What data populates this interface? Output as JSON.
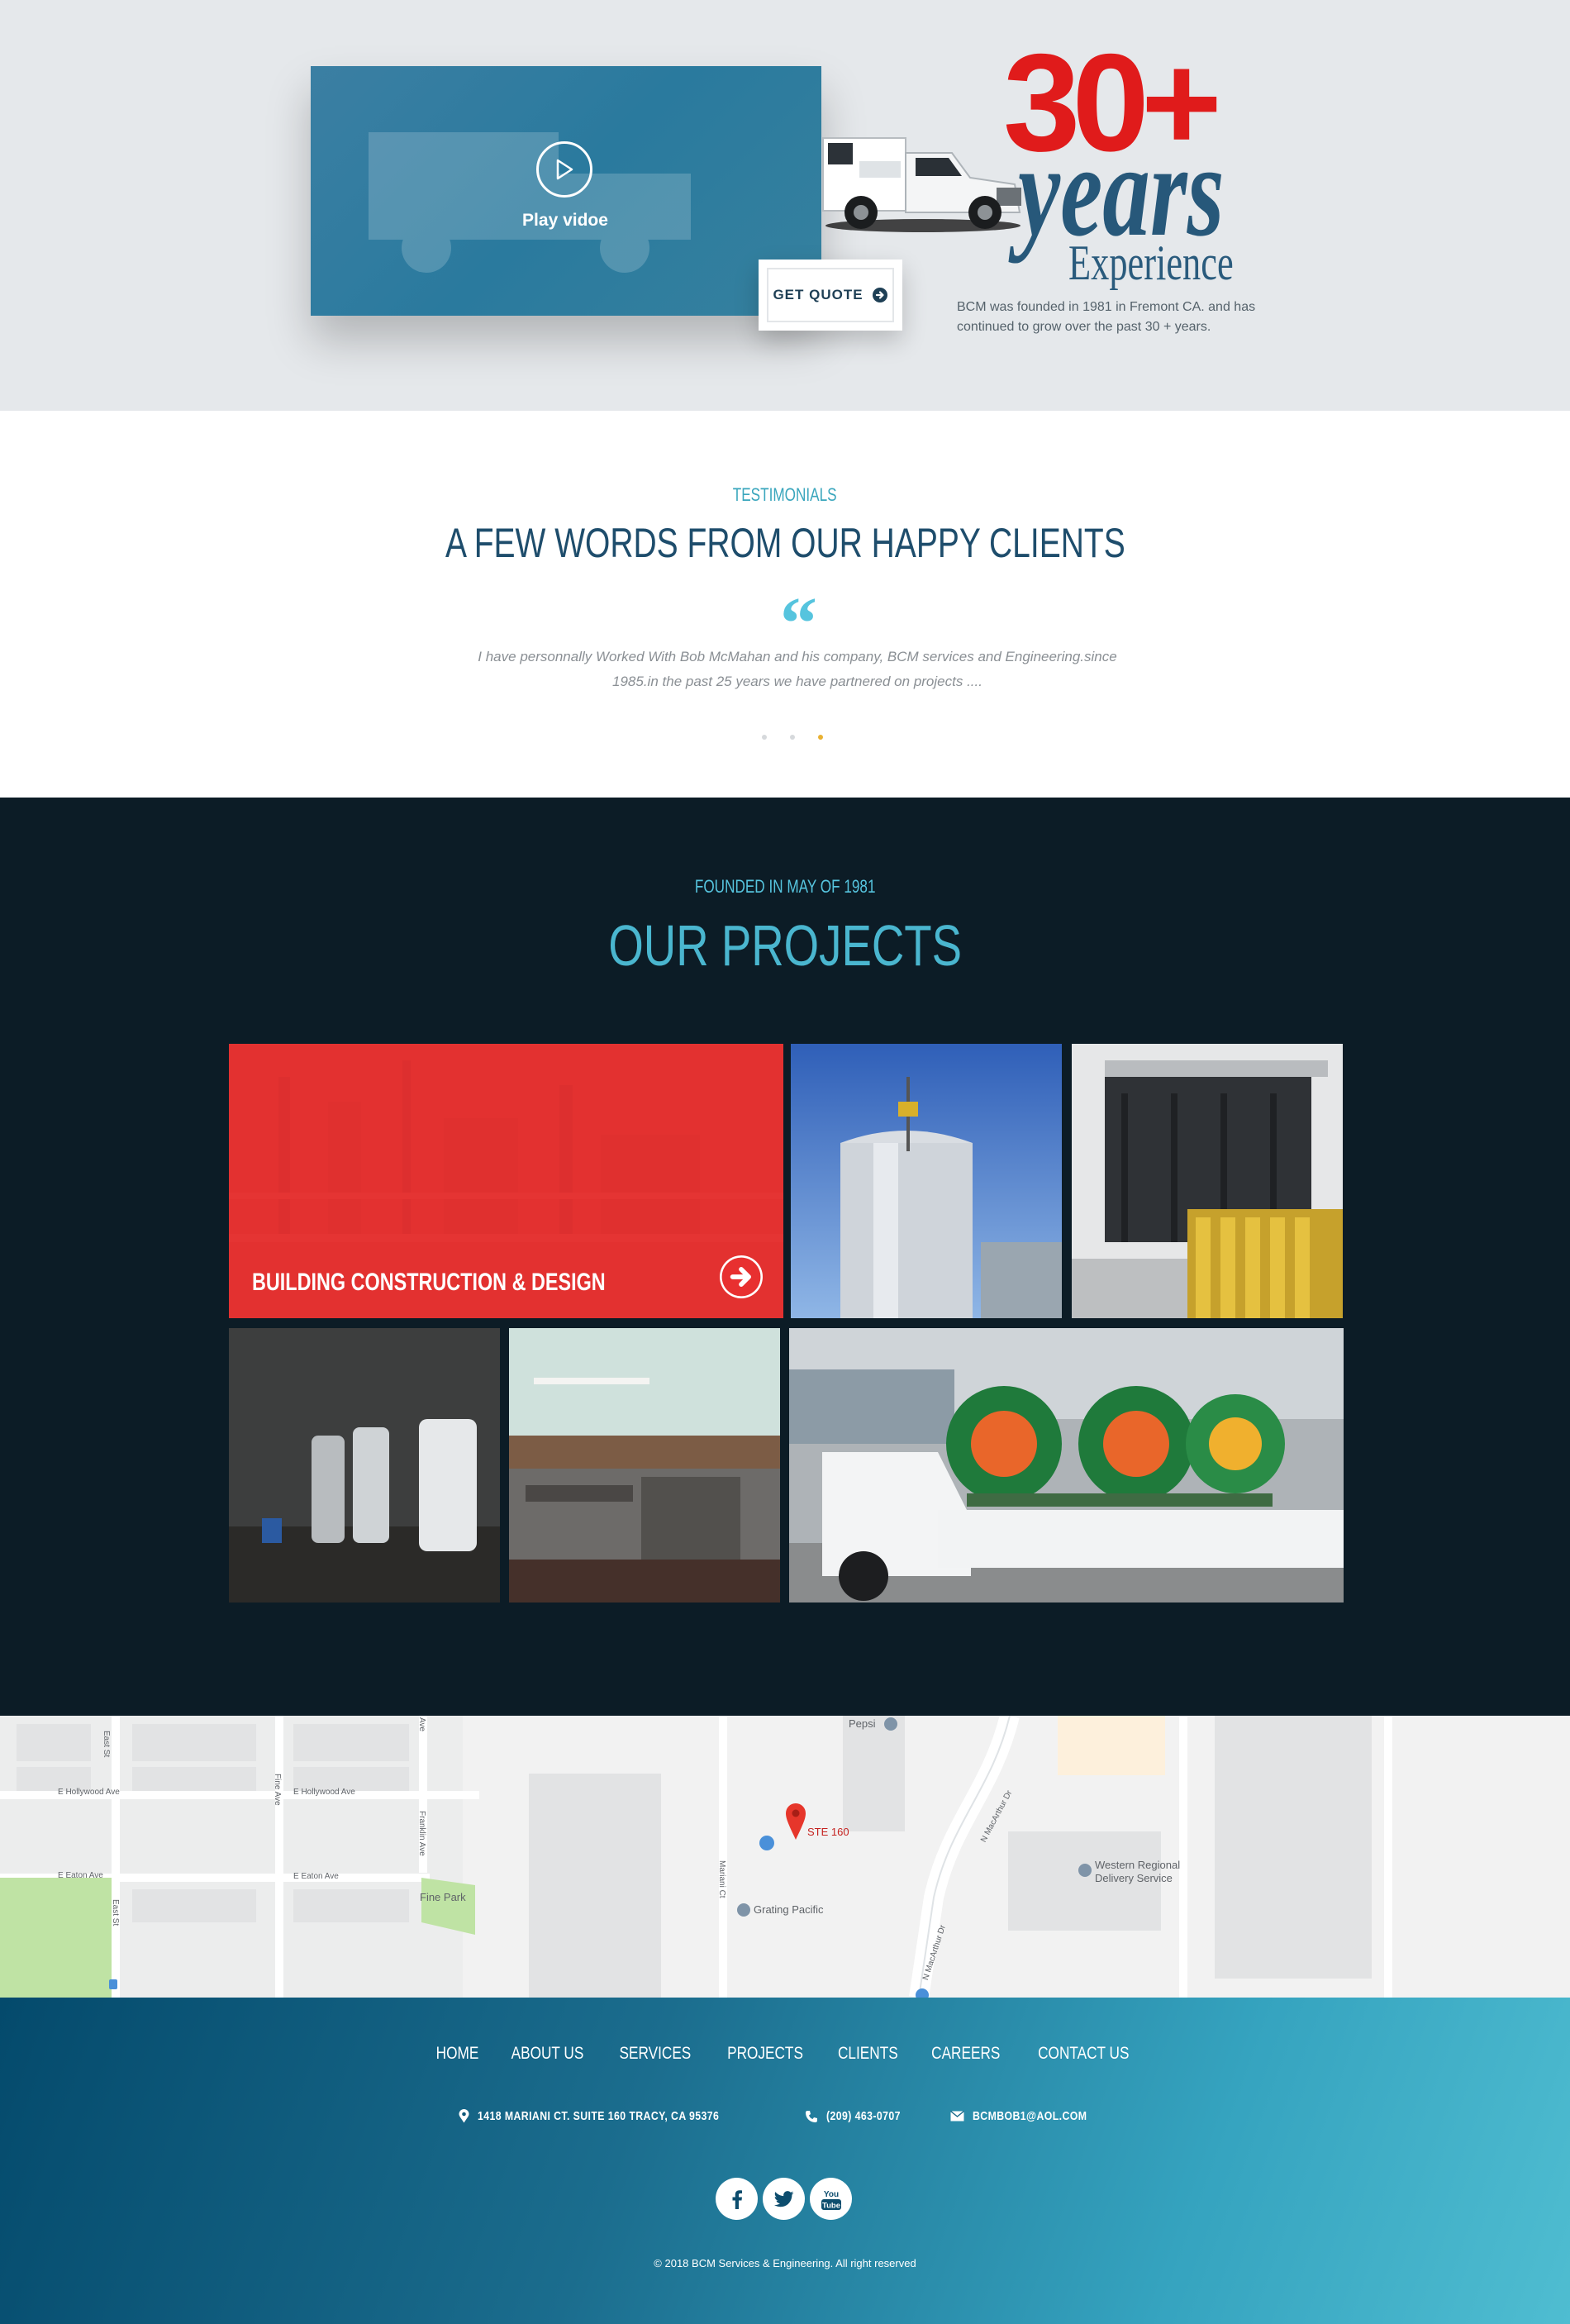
{
  "hero": {
    "play_label": "Play vidoe",
    "get_quote_label": "GET QUOTE",
    "badge_number": "30+",
    "badge_word": "years",
    "badge_sub": "Experience",
    "description": "BCM was founded in 1981 in Fremont CA. and has continued to grow over the past 30 + years."
  },
  "testimonials": {
    "eyebrow": "TESTIMONIALS",
    "title": "A FEW WORDS FROM OUR HAPPY CLIENTS",
    "quote": "I have personnally Worked With Bob McMahan and his company, BCM services and Engineering.since 1985.in the past 25 years we have partnered on projects ....",
    "dots": 3,
    "active_dot": 3
  },
  "projects": {
    "eyebrow": "FOUNDED IN MAY OF 1981",
    "title": "OUR PROJECTS",
    "featured_caption": "BUILDING CONSTRUCTION & DESIGN"
  },
  "map": {
    "labels": {
      "pepsi": "Pepsi",
      "marker": "STE 160",
      "grating": "Grating Pacific",
      "western": "Western Regional",
      "western2": "Delivery Service",
      "fine_park": "Fine Park",
      "e_hollywood_1": "E Hollywood Ave",
      "e_hollywood_2": "E Hollywood Ave",
      "e_eaton_1": "E Eaton Ave",
      "e_eaton_2": "E Eaton Ave",
      "east_st": "East St",
      "east_st_2": "East St",
      "fine_ave": "Fine Ave",
      "franklin_ave": "Franklin Ave",
      "ave": "Ave",
      "mariani_ct": "Mariani Ct",
      "macarthur_1": "N MacArthur Dr",
      "macarthur_2": "N MacArthur Dr"
    }
  },
  "footer": {
    "nav": [
      "HOME",
      "ABOUT US",
      "SERVICES",
      "PROJECTS",
      "CLIENTS",
      "CAREERS",
      "CONTACT US"
    ],
    "address": "1418 MARIANI CT. SUITE 160 TRACY, CA 95376",
    "phone": "(209) 463-0707",
    "email": "BCMBOB1@AOL.COM",
    "social": [
      "facebook-icon",
      "twitter-icon",
      "youtube-icon"
    ],
    "youtube_text": "You Tube",
    "copyright": "© 2018 BCM Services & Engineering. All right reserved"
  },
  "colors": {
    "accent_red": "#e01b1b",
    "navy": "#1e4d6c",
    "teal": "#4ab6cf",
    "dark_bg": "#0c1c26",
    "dot_active": "#e9b132"
  }
}
